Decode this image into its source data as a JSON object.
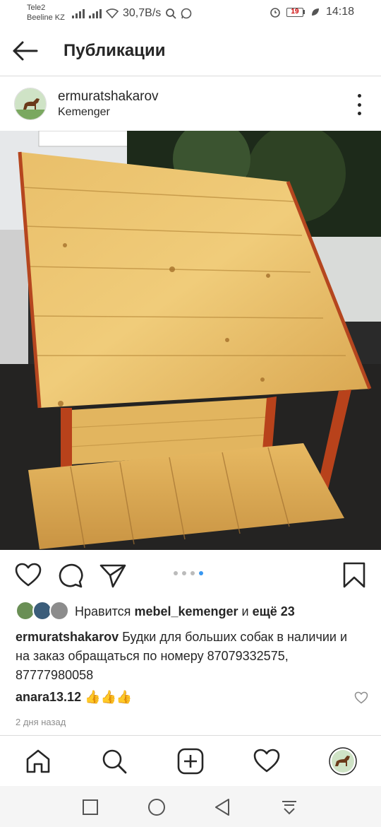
{
  "status_bar": {
    "carrier_1": "Tele2",
    "carrier_2": "Beeline KZ",
    "speed": "30,7B/s",
    "battery": "19",
    "time": "14:18"
  },
  "header": {
    "title": "Публикации",
    "back_icon": "arrow-left-icon"
  },
  "post": {
    "username": "ermuratshakarov",
    "location": "Kemenger",
    "photo_description_icon": "dog-house-photo",
    "carousel": {
      "count": 4,
      "active_index": 3
    },
    "likes": {
      "prefix": "Нравится ",
      "user": "mebel_kemenger",
      "middle": " и ",
      "others": "ещё 23"
    },
    "caption": {
      "author": "ermuratshakarov",
      "text": " Будки для больших собак в наличии и на заказ обращаться по номеру 87079332575, 87777980058"
    },
    "comment": {
      "author": "anara13.12",
      "text": " 👍👍👍"
    },
    "time_ago": "2 дня назад"
  },
  "colors": {
    "link_blue": "#3897f0",
    "text": "#262626",
    "muted": "#8e8e8e"
  }
}
